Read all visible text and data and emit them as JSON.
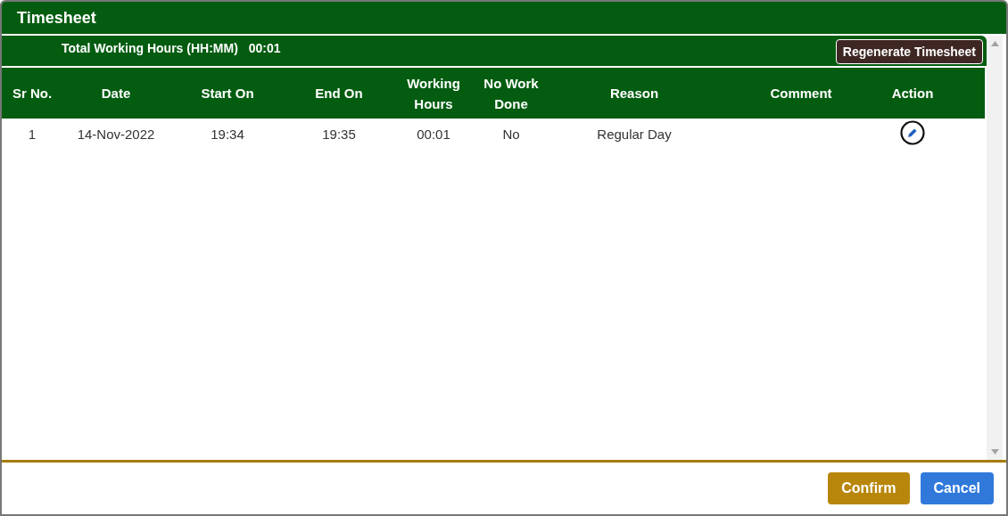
{
  "window": {
    "title": "Timesheet"
  },
  "summary": {
    "label": "Total Working Hours (HH:MM)",
    "value": "00:01"
  },
  "regenerate_button": "Regenerate Timesheet",
  "table": {
    "columns": [
      "Sr No.",
      "Date",
      "Start On",
      "End On",
      "Working Hours",
      "No Work Done",
      "Reason",
      "Comment",
      "Action"
    ],
    "rows": [
      {
        "cells": [
          "1",
          "14-Nov-2022",
          "19:34",
          "19:35",
          "00:01",
          "No",
          "Regular Day"
        ],
        "editable": true
      }
    ]
  },
  "buttons": [
    {
      "label": "Confirm",
      "kind": "confirm"
    },
    {
      "label": "Cancel",
      "kind": "cancel"
    }
  ]
}
